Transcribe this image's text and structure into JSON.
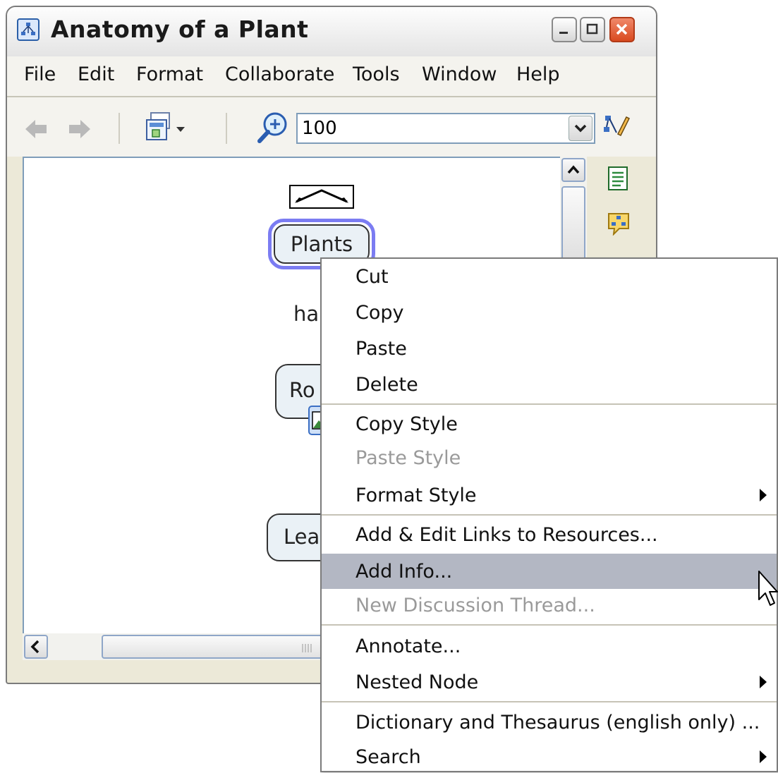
{
  "window": {
    "title": "Anatomy of a Plant"
  },
  "menubar": {
    "items": [
      "File",
      "Edit",
      "Format",
      "Collaborate",
      "Tools",
      "Window",
      "Help"
    ]
  },
  "toolbar": {
    "back_icon": "back-arrow-icon",
    "forward_icon": "forward-arrow-icon",
    "view_icon": "view-options-icon",
    "zoom_icon": "zoom-in-icon",
    "zoom_value": "100",
    "style_icon": "styles-palette-icon"
  },
  "canvas": {
    "nodes": [
      "Plants",
      "ha",
      "Ro",
      "Lea"
    ]
  },
  "side_panel": {
    "icons": [
      "notes-list-icon",
      "concept-map-comment-icon"
    ]
  },
  "context_menu": {
    "groups": [
      [
        {
          "label": "Cut",
          "enabled": true
        },
        {
          "label": "Copy",
          "enabled": true
        },
        {
          "label": "Paste",
          "enabled": true
        },
        {
          "label": "Delete",
          "enabled": true
        }
      ],
      [
        {
          "label": "Copy Style",
          "enabled": true
        },
        {
          "label": "Paste Style",
          "enabled": false
        },
        {
          "label": "Format Style",
          "enabled": true,
          "submenu": true
        }
      ],
      [
        {
          "label": "Add & Edit Links to Resources...",
          "enabled": true
        },
        {
          "label": "Add Info...",
          "enabled": true,
          "highlighted": true
        },
        {
          "label": "New Discussion Thread...",
          "enabled": false
        }
      ],
      [
        {
          "label": "Annotate...",
          "enabled": true
        },
        {
          "label": "Nested Node",
          "enabled": true,
          "submenu": true
        }
      ],
      [
        {
          "label": "Dictionary and Thesaurus (english only) ...",
          "enabled": true
        },
        {
          "label": "Search",
          "enabled": true,
          "submenu": true
        }
      ]
    ]
  },
  "colors": {
    "highlight": "#b3b7c3",
    "selection_ring": "#7b7cf2",
    "close_button": "#d94a20"
  }
}
